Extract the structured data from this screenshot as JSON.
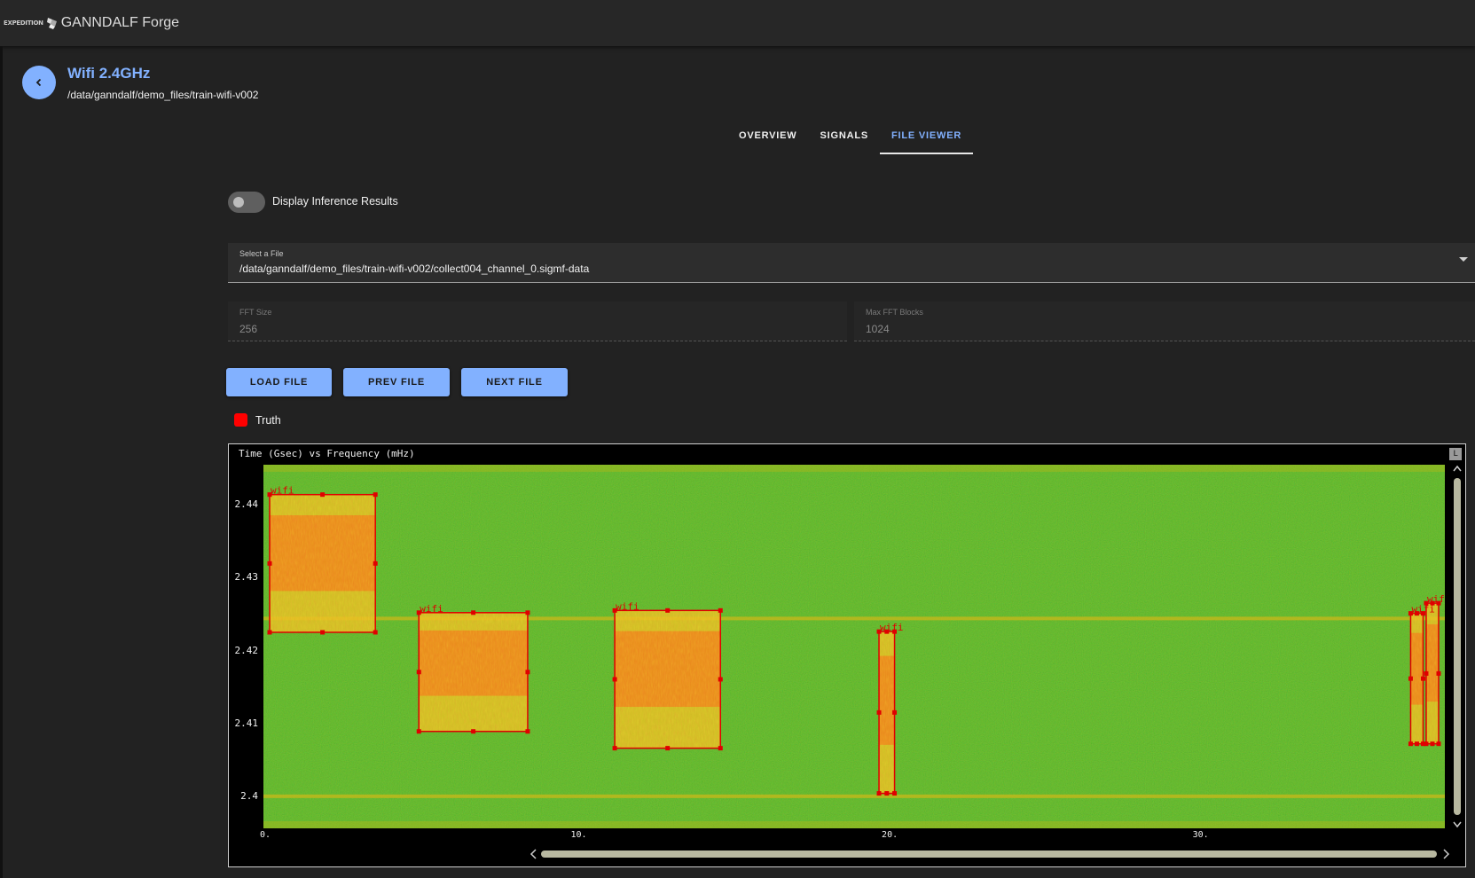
{
  "app": {
    "logo_text": "EXPEDITION",
    "title": "GANNDALF Forge"
  },
  "page": {
    "title": "Wifi 2.4GHz",
    "path": "/data/ganndalf/demo_files/train-wifi-v002"
  },
  "tabs": [
    {
      "label": "OVERVIEW",
      "active": false
    },
    {
      "label": "SIGNALS",
      "active": false
    },
    {
      "label": "FILE VIEWER",
      "active": true
    }
  ],
  "toggle": {
    "label": "Display Inference Results",
    "on": false
  },
  "file_select": {
    "label": "Select a File",
    "value": "/data/ganndalf/demo_files/train-wifi-v002/collect004_channel_0.sigmf-data"
  },
  "fft_size": {
    "label": "FFT Size",
    "value": "256"
  },
  "max_fft_blocks": {
    "label": "Max FFT Blocks",
    "value": "1024"
  },
  "buttons": {
    "load": "LOAD FILE",
    "prev": "PREV FILE",
    "next": "NEXT FILE"
  },
  "legend": {
    "label": "Truth",
    "color": "#ff0000"
  },
  "icons": {
    "back": "chevron-left-icon",
    "dropdown": "caret-down-icon",
    "scroll_left": "chevron-left-icon",
    "scroll_right": "chevron-right-icon"
  },
  "colors": {
    "accent": "#82b1ff",
    "background": "#222222",
    "truth": "#ff0000",
    "spectrogram_base": "#3ca51e"
  },
  "chart_data": {
    "type": "heatmap",
    "title": "Time (Gsec) vs Frequency (mHz)",
    "corner_button": "L",
    "xlabel": "",
    "ylabel": "",
    "x_ticks": [
      "0.",
      "10.",
      "20.",
      "30."
    ],
    "x_tick_values": [
      0,
      10,
      20,
      30
    ],
    "y_ticks": [
      "2.44",
      "2.43",
      "2.42",
      "2.41",
      "2.4"
    ],
    "y_tick_values": [
      2.44,
      2.43,
      2.42,
      2.41,
      2.4
    ],
    "xlim": [
      0,
      38
    ],
    "ylim": [
      2.3956,
      2.4455
    ],
    "annotations": [
      {
        "label": "wifi",
        "x0": 0.2,
        "x1": 3.6,
        "y0": 2.4225,
        "y1": 2.4414
      },
      {
        "label": "wifi",
        "x0": 5.0,
        "x1": 8.5,
        "y0": 2.4089,
        "y1": 2.4252
      },
      {
        "label": "wifi",
        "x0": 11.3,
        "x1": 14.7,
        "y0": 2.4066,
        "y1": 2.4255
      },
      {
        "label": "wifi",
        "x0": 19.8,
        "x1": 20.3,
        "y0": 2.4004,
        "y1": 2.4226
      },
      {
        "label": "wifi",
        "x0": 36.9,
        "x1": 37.3,
        "y0": 2.4072,
        "y1": 2.4251
      },
      {
        "label": "wifi",
        "x0": 37.4,
        "x1": 37.8,
        "y0": 2.4072,
        "y1": 2.4265
      }
    ],
    "horizontal_lines": [
      2.4,
      2.4244
    ],
    "grid": false
  }
}
